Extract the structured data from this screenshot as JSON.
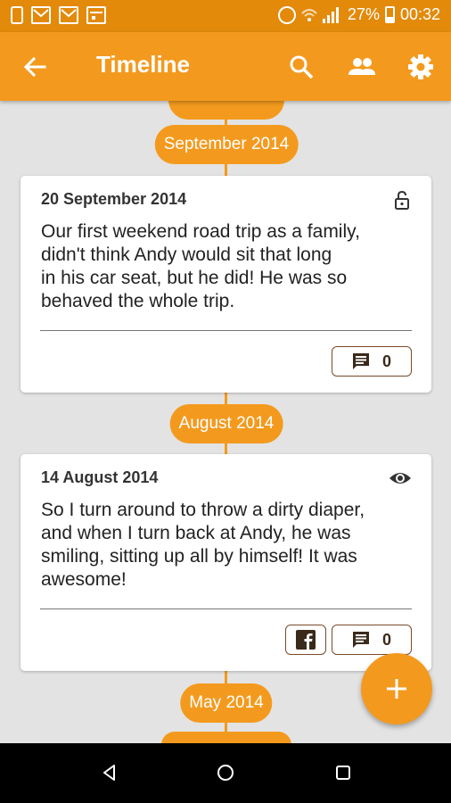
{
  "status_bar": {
    "battery_percent": "27%",
    "time": "00:32",
    "left_icons": [
      "phone-icon",
      "gmail-icon",
      "gmail-icon",
      "calendar-icon"
    ],
    "right_icons": [
      "alarm-icon",
      "wifi-icon",
      "signal-icon",
      "battery-icon"
    ]
  },
  "app_bar": {
    "title": "Timeline",
    "actions": [
      "search-icon",
      "people-icon",
      "settings-icon"
    ],
    "color": "#f39a1e"
  },
  "timeline": {
    "months": [
      "September 2014",
      "August 2014",
      "May 2014"
    ],
    "entries": [
      {
        "date": "20 September 2014",
        "visibility_icon": "lock-icon",
        "text_lines": [
          "Our first weekend road trip as a family,",
          "didn't think Andy would sit that long",
          "in his car seat, but he did! He was so",
          "behaved the whole trip."
        ],
        "comment_count": "0"
      },
      {
        "date": "14 August 2014",
        "visibility_icon": "eye-icon",
        "text_lines": [
          "So I turn around to throw a dirty diaper,",
          "and when I turn back at Andy, he was",
          "smiling, sitting up all by himself! It was",
          "awesome!"
        ],
        "comment_count": "0",
        "share_icon": "facebook-icon"
      }
    ]
  },
  "fab": {
    "icon": "plus-icon"
  },
  "nav_bar": {
    "icons": [
      "back-triangle-icon",
      "home-circle-icon",
      "recents-square-icon"
    ]
  }
}
